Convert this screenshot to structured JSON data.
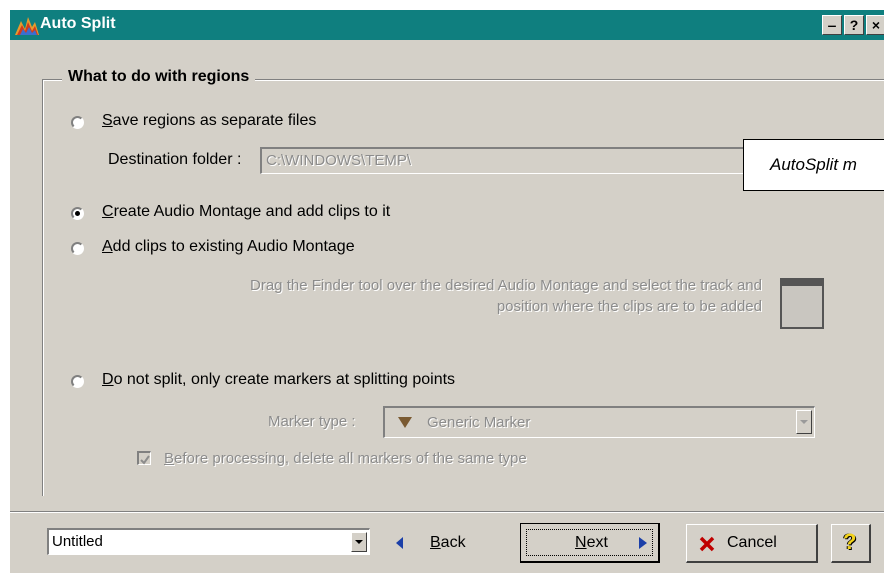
{
  "window": {
    "title": "Auto Split"
  },
  "titlebar": {
    "minimize": "‒",
    "help": "?",
    "close": "×"
  },
  "group": {
    "title": "What to do with regions"
  },
  "options": {
    "save_separate": {
      "key": "S",
      "rest": "ave regions as separate files",
      "checked": false
    },
    "destination_label": "Destination folder :",
    "destination_value": "C:\\WINDOWS\\TEMP\\",
    "create_montage": {
      "key": "C",
      "rest": "reate Audio Montage and add clips to it",
      "checked": true
    },
    "add_existing": {
      "key": "A",
      "rest": "dd clips to existing Audio Montage",
      "checked": false
    },
    "finder_help_line1": "Drag the Finder tool over the desired Audio Montage and select the track and",
    "finder_help_line2": "position where the clips are to be added",
    "markers_only": {
      "key": "D",
      "rest": "o not split, only create markers at splitting points",
      "checked": false
    },
    "marker_type_label": "Marker type :",
    "marker_type_value": "Generic Marker",
    "delete_markers": {
      "key": "B",
      "rest": "efore processing, delete all markers of the same type",
      "checked": true
    }
  },
  "tooltip": {
    "text": "AutoSplit m"
  },
  "footer": {
    "preset_value": "Untitled",
    "back": {
      "key": "B",
      "rest": "ack"
    },
    "next": {
      "key": "N",
      "rest": "ext"
    },
    "cancel": "Cancel",
    "help": "?"
  },
  "colors": {
    "titlebar": "#0f7f7f",
    "face": "#d4d0c8",
    "nav_arrow": "#1b3fa8",
    "cancel_x": "#c00000",
    "help_yellow": "#f2d21b"
  }
}
